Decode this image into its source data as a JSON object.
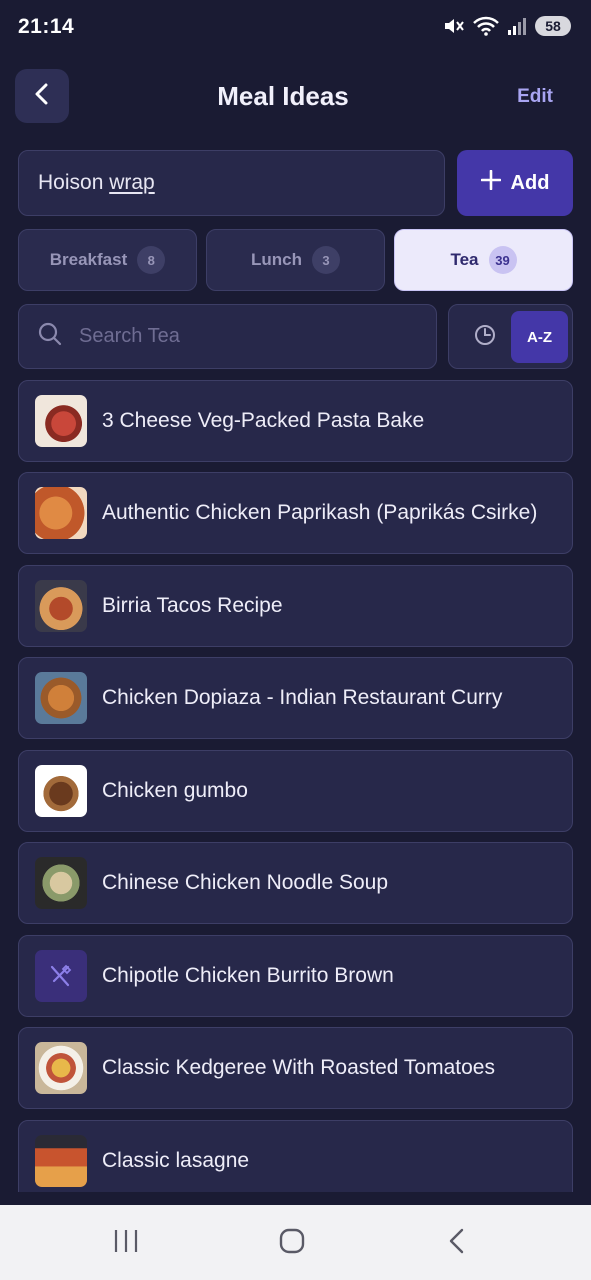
{
  "status_bar": {
    "time": "21:14",
    "battery": "58",
    "icons": [
      "mute-icon",
      "wifi-icon",
      "signal-icon",
      "battery-icon"
    ]
  },
  "header": {
    "title": "Meal Ideas",
    "edit_label": "Edit",
    "back_icon": "chevron-left-icon"
  },
  "add_meal": {
    "input_value_part1": "Hoison ",
    "input_value_part2": "wrap",
    "add_label": "Add"
  },
  "tabs": [
    {
      "label": "Breakfast",
      "count": "8",
      "active": false
    },
    {
      "label": "Lunch",
      "count": "3",
      "active": false
    },
    {
      "label": "Tea",
      "count": "39",
      "active": true
    }
  ],
  "search": {
    "placeholder": "Search Tea",
    "sort_az_label": "A-Z"
  },
  "meals": [
    {
      "name": "3 Cheese Veg-Packed Pasta Bake"
    },
    {
      "name": "Authentic Chicken Paprikash (Paprikás Csirke)"
    },
    {
      "name": "Birria Tacos Recipe"
    },
    {
      "name": "Chicken Dopiaza - Indian Restaurant Curry"
    },
    {
      "name": "Chicken gumbo"
    },
    {
      "name": "Chinese Chicken Noodle Soup"
    },
    {
      "name": "Chipotle Chicken Burrito Brown"
    },
    {
      "name": "Classic Kedgeree With Roasted Tomatoes"
    },
    {
      "name": "Classic lasagne"
    }
  ],
  "colors": {
    "background": "#1a1b33",
    "card": "#27284a",
    "accent": "#4437a8",
    "active_tab": "#eceafb"
  }
}
